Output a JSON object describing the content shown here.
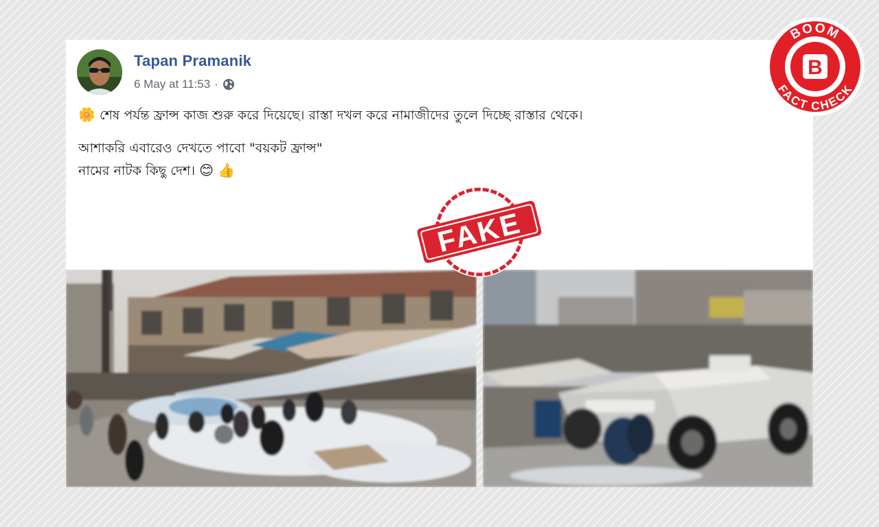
{
  "post": {
    "author": "Tapan Pramanik",
    "timestamp": "6 May at 11:53",
    "separator": "·",
    "privacy_icon": "globe-icon",
    "lines": [
      "শেষ পর্যন্ত ফ্রান্স কাজ শুরু করে দিয়েছে। রাস্তা দখল করে নামাজীদের তুলে দিচ্ছে রাস্তার থেকে।",
      "আশাকরি এবারেও দেখতে পাবো \"বয়কট ফ্রান্স\"",
      "নামের নাটক কিছু দেশ।"
    ],
    "emoji_sun": "🌼",
    "emoji_smile": "😊",
    "emoji_thumb": "👍"
  },
  "overlay": {
    "stamp_text": "FAKE",
    "logo_top": "BOOM",
    "logo_letter": "B",
    "logo_bottom": "FACT CHECK"
  },
  "colors": {
    "facebook_name": "#385898",
    "meta_gray": "#606770",
    "stamp_red": "#d9232e",
    "boom_red": "#e21f26"
  }
}
